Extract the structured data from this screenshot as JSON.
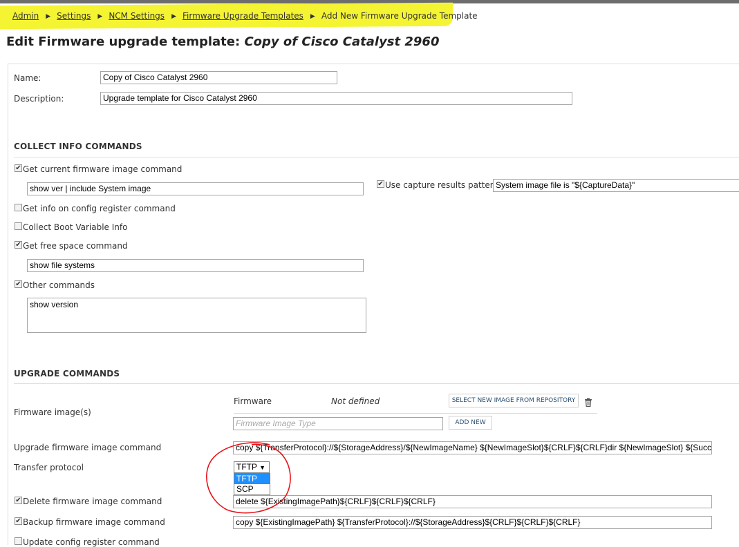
{
  "breadcrumb": {
    "items": [
      "Admin",
      "Settings",
      "NCM Settings",
      "Firmware Upgrade Templates"
    ],
    "current": "Add New Firmware Upgrade Template",
    "separator": "▶"
  },
  "page": {
    "title_prefix": "Edit Firmware upgrade template: ",
    "title_name": "Copy of Cisco Catalyst 2960"
  },
  "form": {
    "name_label": "Name:",
    "name_value": "Copy of Cisco Catalyst 2960",
    "description_label": "Description:",
    "description_value": "Upgrade template for Cisco Catalyst 2960"
  },
  "collect": {
    "heading": "COLLECT INFO COMMANDS",
    "get_firmware_label": "Get current firmware image command",
    "get_firmware_checked": true,
    "get_firmware_value": "show ver | include System image",
    "capture_label": "Use capture results pattern",
    "capture_checked": true,
    "capture_value": "System image file is \"${CaptureData}\"",
    "config_register_label": "Get info on config register command",
    "config_register_checked": false,
    "boot_variable_label": "Collect Boot Variable Info",
    "boot_variable_checked": false,
    "free_space_label": "Get free space command",
    "free_space_checked": true,
    "free_space_value": "show file systems",
    "other_label": "Other commands",
    "other_checked": true,
    "other_value": "show version"
  },
  "upgrade": {
    "heading": "UPGRADE COMMANDS",
    "firmware_images_label": "Firmware image(s)",
    "firmware_col_label": "Firmware",
    "firmware_status": "Not defined",
    "select_image_button": "SELECT NEW IMAGE FROM REPOSITORY",
    "image_type_placeholder": "Firmware Image Type",
    "add_new_button": "ADD NEW",
    "upgrade_command_label": "Upgrade firmware image command",
    "upgrade_command_value": "copy ${TransferProtocol}://${StorageAddress}/${NewImageName} ${NewImageSlot}${CRLF}${CRLF}dir ${NewImageSlot} ${SuccessPattern}",
    "transfer_protocol_label": "Transfer protocol",
    "transfer_protocol_value": "TFTP",
    "transfer_protocol_options": [
      "TFTP",
      "SCP"
    ],
    "delete_label": "Delete firmware image command",
    "delete_checked": true,
    "delete_value": "delete ${ExistingImagePath}${CRLF}${CRLF}${CRLF}",
    "backup_label": "Backup firmware image command",
    "backup_checked": true,
    "backup_value": "copy ${ExistingImagePath} ${TransferProtocol}://${StorageAddress}${CRLF}${CRLF}${CRLF}",
    "update_register_label": "Update config register command",
    "update_register_checked": false
  },
  "colors": {
    "highlight": "#f4f433",
    "annotation_circle": "#e8141a",
    "dropdown_selected": "#1e90ff"
  }
}
